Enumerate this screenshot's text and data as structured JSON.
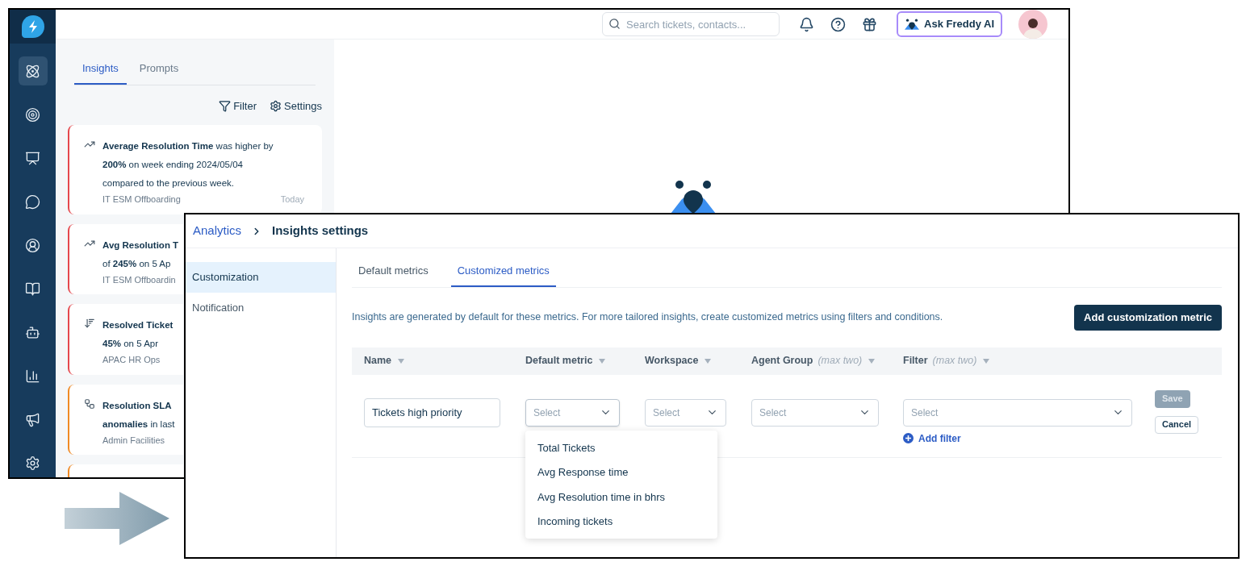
{
  "back_window": {
    "sidebar": {
      "items": [
        {
          "kind": "insights",
          "selected": true
        },
        {
          "kind": "goals",
          "selected": false
        },
        {
          "kind": "dashboard",
          "selected": false
        },
        {
          "kind": "chat",
          "selected": false
        },
        {
          "kind": "contacts",
          "selected": false
        },
        {
          "kind": "book",
          "selected": false
        },
        {
          "kind": "bot",
          "selected": false
        },
        {
          "kind": "reports",
          "selected": false
        },
        {
          "kind": "announce",
          "selected": false
        },
        {
          "kind": "settings",
          "selected": false
        }
      ]
    },
    "topbar": {
      "search": {
        "placeholder": "Search tickets, contacts..."
      },
      "ask_button": "Ask Freddy AI"
    },
    "panel": {
      "tabs": [
        {
          "label": "Insights",
          "selected": true
        },
        {
          "label": "Prompts",
          "selected": false
        }
      ],
      "actions": [
        {
          "kind": "filter",
          "label": "Filter"
        },
        {
          "kind": "settings",
          "label": "Settings"
        }
      ],
      "cards": [
        {
          "kind": "trend",
          "color": "#e5484d",
          "lines": [
            "**Average Resolution Time** was higher by",
            "**200%** on week ending 2024/05/04",
            "compared to the previous week."
          ],
          "meta": "IT ESM Offboarding",
          "time": "Today"
        },
        {
          "kind": "trend",
          "color": "#e5484d",
          "lines": [
            "**Avg Resolution T**",
            "of **245%** on 5 Ap"
          ],
          "meta": "IT ESM Offboardin"
        },
        {
          "kind": "sort",
          "color": "#e5484d",
          "lines": [
            "**Resolved Ticket**",
            "**45%** on 5 Apr"
          ],
          "meta": "APAC HR Ops"
        },
        {
          "kind": "flow",
          "color": "#f08a24",
          "lines": [
            "**Resolution SLA**",
            "**anomalies** in last"
          ],
          "meta": "Admin Facilities"
        },
        {
          "kind": "none",
          "color": "#f08a24"
        }
      ]
    }
  },
  "front_window": {
    "breadcrumb": {
      "link": "Analytics",
      "current": "Insights settings"
    },
    "nav": [
      {
        "label": "Customization",
        "selected": true
      },
      {
        "label": "Notification",
        "selected": false
      }
    ],
    "tabs": [
      {
        "label": "Default metrics",
        "selected": false
      },
      {
        "label": "Customized metrics",
        "selected": true
      }
    ],
    "description": "Insights are generated by default for these metrics. For more tailored insights, create customized metrics using filters and conditions.",
    "add_button": "Add customization metric",
    "columns": [
      {
        "label": "Name"
      },
      {
        "label": "Default metric"
      },
      {
        "label": "Workspace"
      },
      {
        "label": "Agent Group",
        "hint": "(max two)"
      },
      {
        "label": "Filter",
        "hint": "(max two)"
      }
    ],
    "row": {
      "name": "Tickets high priority",
      "selects": [
        {
          "placeholder": "Select",
          "open": true
        },
        {
          "placeholder": "Select",
          "open": false
        },
        {
          "placeholder": "Select",
          "open": false
        },
        {
          "placeholder": "Select",
          "open": false
        }
      ],
      "add_filter": "Add filter",
      "save": {
        "label": "Save",
        "disabled": true
      },
      "cancel": "Cancel"
    },
    "dropdown": [
      "Total Tickets",
      "Avg Response time",
      "Avg Resolution time in bhrs",
      "Incoming tickets"
    ]
  }
}
